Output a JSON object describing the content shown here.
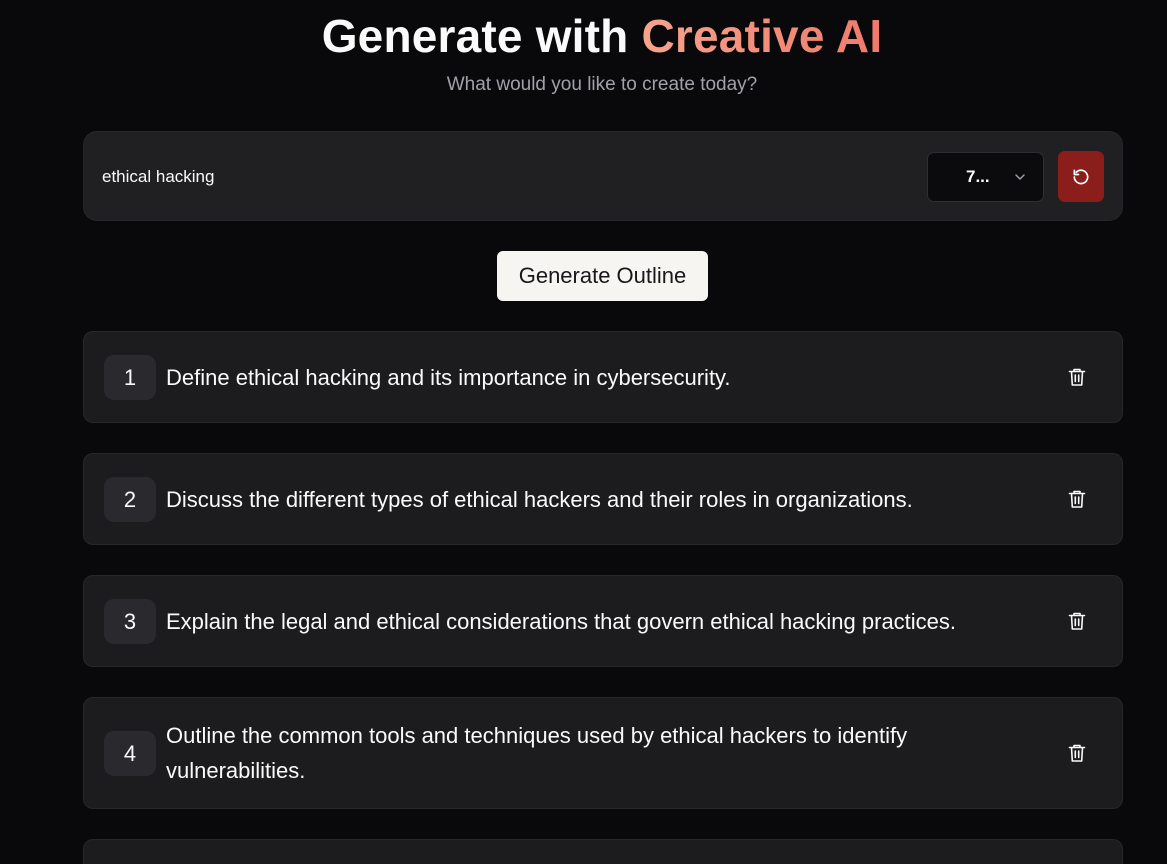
{
  "hero": {
    "title_prefix": "Generate with ",
    "title_accent": "Creative AI",
    "subtitle": "What would you like to create today?"
  },
  "prompt": {
    "value": "ethical hacking",
    "count_selected": "7...",
    "reset_icon": "rotate-ccw-icon",
    "dropdown_icon": "chevron-down-icon"
  },
  "actions": {
    "generate_label": "Generate Outline"
  },
  "outline": {
    "items": [
      {
        "number": "1",
        "text": "Define ethical hacking and its importance in cybersecurity."
      },
      {
        "number": "2",
        "text": "Discuss the different types of ethical hackers and their roles in organizations."
      },
      {
        "number": "3",
        "text": "Explain the legal and ethical considerations that govern ethical hacking practices."
      },
      {
        "number": "4",
        "text": "Outline the common tools and techniques used by ethical hackers to identify vulnerabilities."
      }
    ],
    "delete_icon": "trash-icon"
  },
  "colors": {
    "background": "#09090b",
    "accent_gradient_start": "#f6a48c",
    "accent_gradient_end": "#ef7a6c",
    "reset_button": "#8b1d1b",
    "card": "#1c1c1f"
  }
}
